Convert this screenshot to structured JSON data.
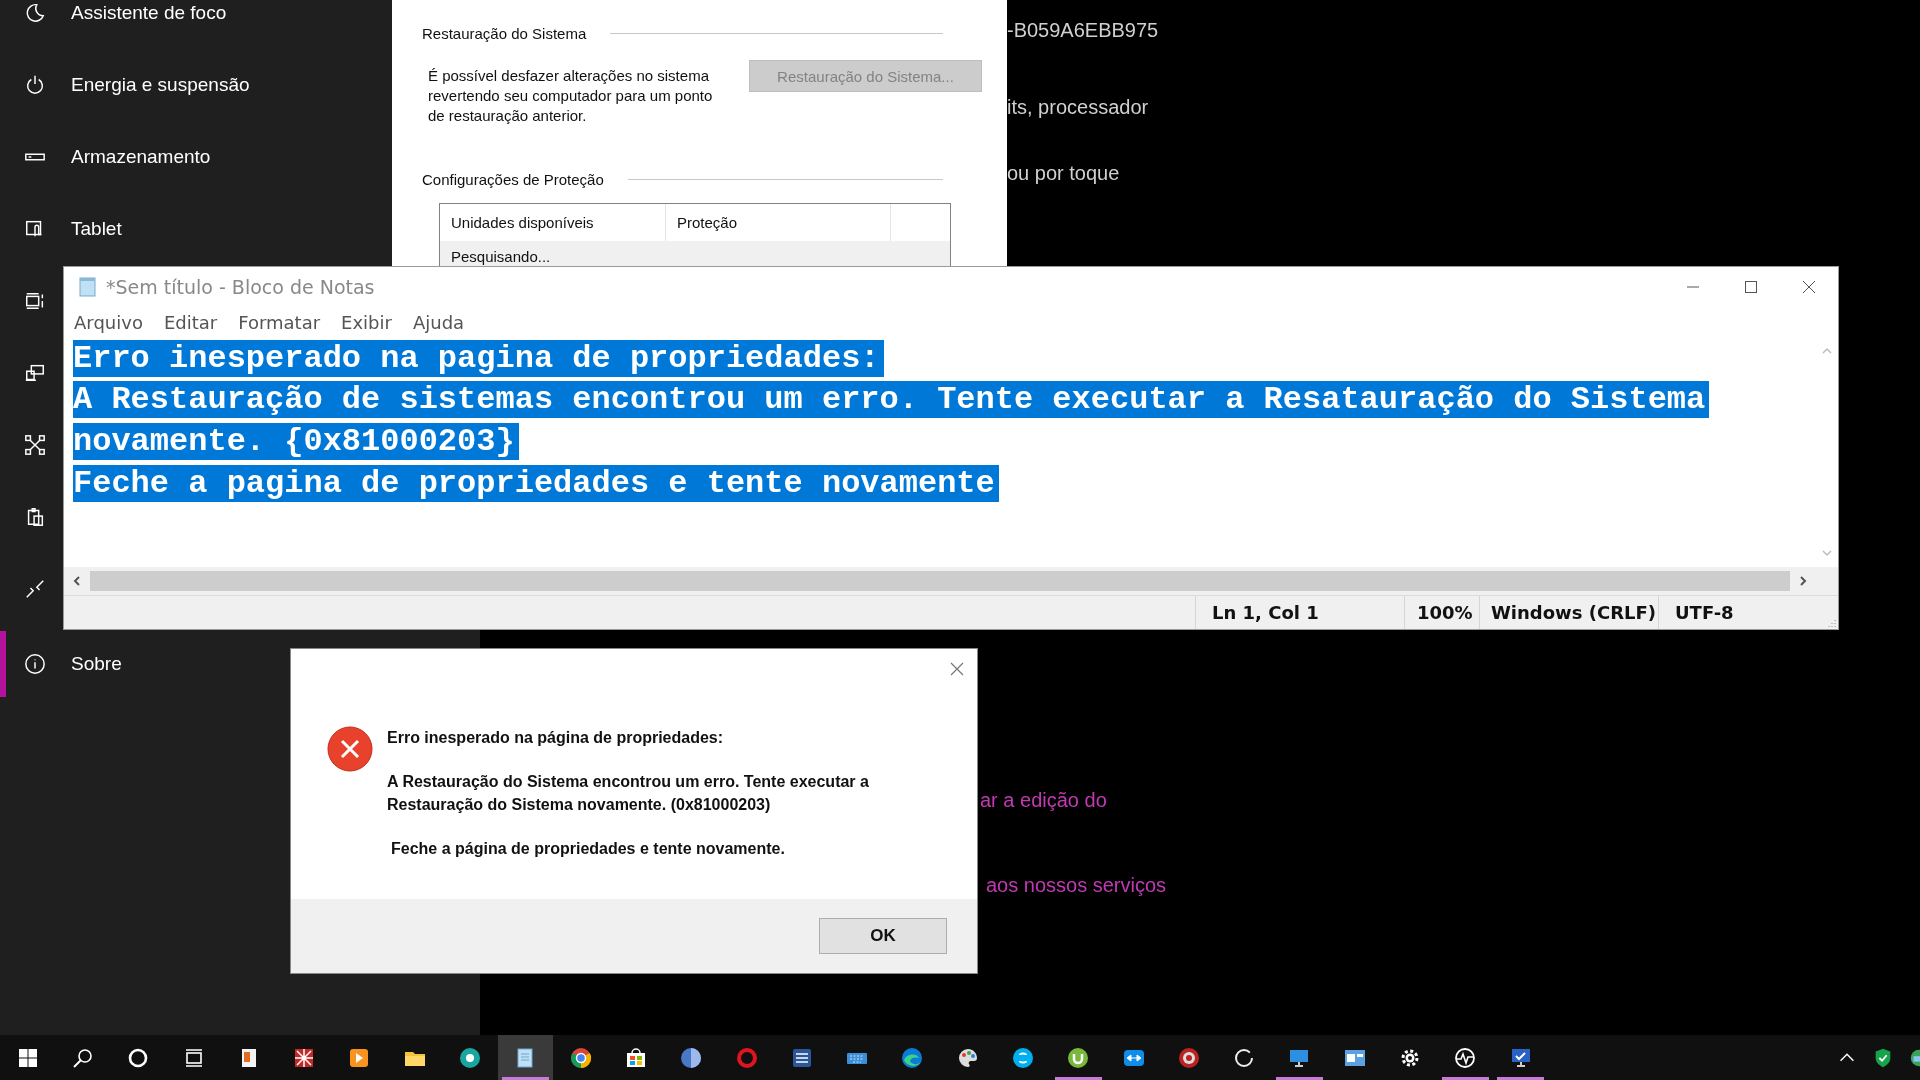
{
  "settings": {
    "sidebar": [
      {
        "kind": "moon",
        "label": "Assistente de foco",
        "selected": false
      },
      {
        "kind": "power",
        "label": "Energia e suspensão",
        "selected": false
      },
      {
        "kind": "storage",
        "label": "Armazenamento",
        "selected": false
      },
      {
        "kind": "tablet",
        "label": "Tablet",
        "selected": false
      },
      {
        "kind": "multitask",
        "selected": false
      },
      {
        "kind": "project",
        "selected": false
      },
      {
        "kind": "shared",
        "selected": false
      },
      {
        "kind": "clipboard",
        "selected": false
      },
      {
        "kind": "remote",
        "selected": false
      },
      {
        "kind": "info",
        "label": "Sobre",
        "selected": true
      }
    ],
    "content": {
      "device_id": "-B059A6EBB975",
      "system_type": "its, processador",
      "pen_touch": "ou por toque",
      "links": [
        "ar a edição do",
        "aos nossos serviços"
      ]
    }
  },
  "system_properties": {
    "restore_group": {
      "title": "Restauração do Sistema",
      "description": "É possível desfazer alterações no sistema revertendo seu computador para um ponto de restauração anterior.",
      "button": {
        "label": "Restauração do Sistema...",
        "disabled": true
      }
    },
    "protection_group": {
      "title": "Configurações de Proteção",
      "table": {
        "columns": [
          "Unidades disponíveis",
          "Proteção"
        ],
        "rows": [
          [
            "Pesquisando..."
          ]
        ]
      }
    }
  },
  "notepad": {
    "title": "*Sem título - Bloco de Notas",
    "menu": [
      "Arquivo",
      "Editar",
      "Formatar",
      "Exibir",
      "Ajuda"
    ],
    "lines": [
      {
        "text": "Erro inesperado na pagina de propriedades:",
        "selected": true
      },
      {
        "text": "A Restauração de sistemas encontrou um erro. Tente executar a Resatauração do Sistema",
        "selected": true
      },
      {
        "text": "novamente. {0x81000203}",
        "selected": true
      },
      {
        "text": "Feche a pagina de propriedades e tente novamente",
        "selected": true
      }
    ],
    "status_bar": [
      "Ln 1, Col 1",
      "100%",
      "Windows (CRLF)",
      "UTF-8"
    ]
  },
  "dialog": {
    "heading": "Erro inesperado na página de propriedades:",
    "message": "A Restauração do Sistema encontrou um erro. Tente executar a Restauração do Sistema novamente. (0x81000203)",
    "hint": "Feche a página de propriedades e tente novamente.",
    "button": "OK"
  },
  "taskbar": {
    "apps": [
      {
        "kind": "start",
        "selected": false,
        "running": false
      },
      {
        "kind": "search",
        "selected": false,
        "running": false
      },
      {
        "kind": "cortana",
        "selected": false,
        "running": false
      },
      {
        "kind": "taskview",
        "selected": false,
        "running": false
      },
      {
        "kind": "tiles",
        "selected": false,
        "running": false
      },
      {
        "kind": "pattern",
        "selected": false,
        "running": false
      },
      {
        "kind": "play",
        "selected": false,
        "running": false
      },
      {
        "kind": "folder",
        "selected": false,
        "running": false
      },
      {
        "kind": "tealcircle",
        "selected": false,
        "running": false
      },
      {
        "kind": "notepad",
        "selected": true,
        "running": true
      },
      {
        "kind": "segmented",
        "selected": false,
        "running": false
      },
      {
        "kind": "bag",
        "selected": false,
        "running": false
      },
      {
        "kind": "sphere",
        "selected": false,
        "running": false
      },
      {
        "kind": "redring",
        "selected": false,
        "running": false
      },
      {
        "kind": "bluedoc",
        "selected": false,
        "running": false
      },
      {
        "kind": "keyboard",
        "selected": false,
        "running": false
      },
      {
        "kind": "wave",
        "selected": false,
        "running": false
      },
      {
        "kind": "palette",
        "selected": false,
        "running": false
      },
      {
        "kind": "bubble",
        "selected": false,
        "running": false
      },
      {
        "kind": "greencircle",
        "selected": false,
        "running": true
      },
      {
        "kind": "arrows",
        "selected": false,
        "running": false
      },
      {
        "kind": "disc",
        "selected": false,
        "running": false
      },
      {
        "kind": "ring",
        "selected": false,
        "running": false
      },
      {
        "kind": "monitor",
        "selected": false,
        "running": true
      },
      {
        "kind": "window",
        "selected": false,
        "running": false
      },
      {
        "kind": "gear",
        "selected": false,
        "running": false
      },
      {
        "kind": "pulse",
        "selected": false,
        "running": true
      },
      {
        "kind": "monitorcheck",
        "selected": false,
        "running": true
      }
    ]
  }
}
